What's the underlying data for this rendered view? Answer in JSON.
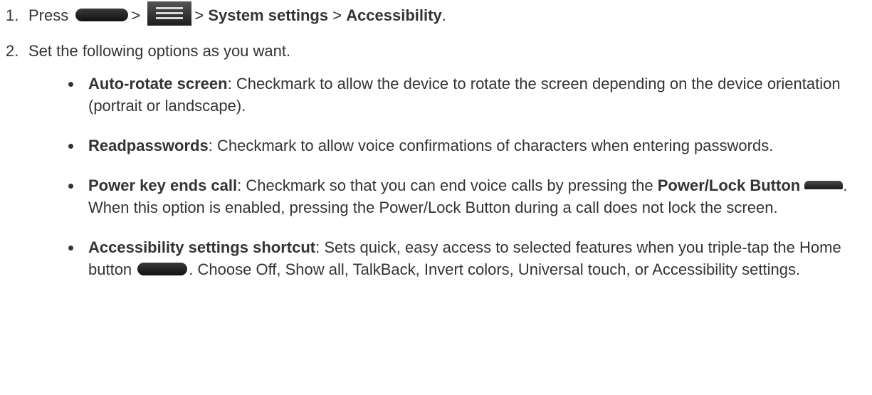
{
  "steps": [
    {
      "num": "1.",
      "pre": "Press",
      "sep1": ">",
      "sep2": ">",
      "item1": "System settings",
      "sep3": ">",
      "item2": "Accessibility",
      "end": "."
    },
    {
      "num": "2.",
      "text": "Set the following options as you want."
    }
  ],
  "options": [
    {
      "term": "Auto-rotate screen",
      "text": ": Checkmark to allow the device to rotate the screen depending on the device orientation (portrait or landscape)."
    },
    {
      "term": "Readpasswords",
      "text": ": Checkmark to allow voice confirmations of characters when entering passwords."
    },
    {
      "term": "Power key ends call",
      "text": ": Checkmark so that you can end voice calls by pressing the",
      "term2": "Power/Lock Button",
      "text2": ". When this option is enabled, pressing the Power/Lock Button during a call does not lock the screen."
    },
    {
      "term": "Accessibility settings shortcut",
      "text": ": Sets quick, easy access to selected features when you triple-tap the Home button",
      "text2": ". Choose Off, Show all, TalkBack, Invert colors, Universal touch, or Accessibility settings."
    }
  ],
  "icons": {
    "home_key": "home-key-icon",
    "menu_key": "menu-key-icon",
    "power_key": "power-lock-key-icon"
  }
}
